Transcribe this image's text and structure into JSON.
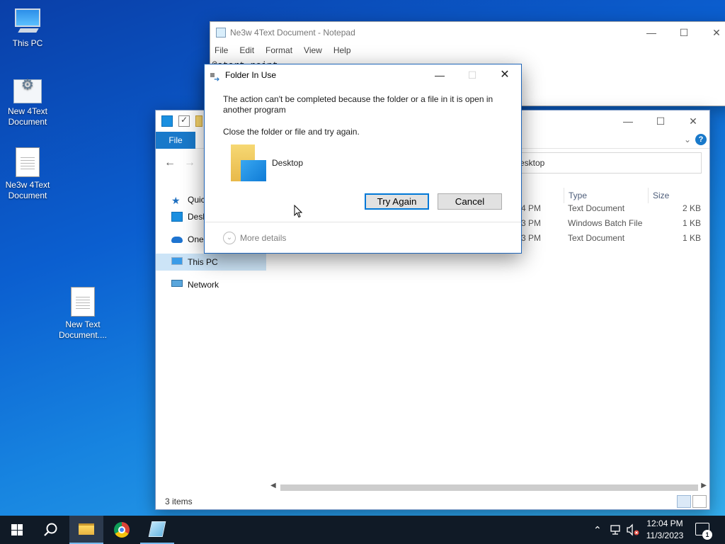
{
  "desktop": {
    "icons": [
      {
        "label": "This PC"
      },
      {
        "label": "New 4Text Document"
      },
      {
        "label": "Ne3w 4Text Document"
      },
      {
        "label": "New Text Document...."
      }
    ]
  },
  "notepad": {
    "title": "Ne3w 4Text Document - Notepad",
    "menu": [
      "File",
      "Edit",
      "Format",
      "View",
      "Help"
    ],
    "text": "@start neint"
  },
  "explorer": {
    "file_tab": "File",
    "address": "esktop",
    "nav": [
      {
        "label": "Quick access"
      },
      {
        "label": "Desktop"
      },
      {
        "label": "OneDrive"
      },
      {
        "label": "This PC"
      },
      {
        "label": "Network"
      }
    ],
    "columns": {
      "type": "Type",
      "size": "Size"
    },
    "rows": [
      {
        "date_tail": "4 PM",
        "type": "Text Document",
        "size": "2 KB"
      },
      {
        "date_tail": "3 PM",
        "type": "Windows Batch File",
        "size": "1 KB"
      },
      {
        "date_tail": "3 PM",
        "type": "Text Document",
        "size": "1 KB"
      }
    ],
    "status": "3 items"
  },
  "dialog": {
    "title": "Folder In Use",
    "message": "The action can't be completed because the folder or a file in it is open in another program",
    "instruction": "Close the folder or file and try again.",
    "folder_name": "Desktop",
    "try_again": "Try Again",
    "cancel": "Cancel",
    "more_details": "More details"
  },
  "taskbar": {
    "time": "12:04 PM",
    "date": "11/3/2023",
    "notification_count": "1"
  },
  "colors": {
    "accent": "#0078d7",
    "file_tab": "#1979ca",
    "taskbar": "#101a26"
  }
}
